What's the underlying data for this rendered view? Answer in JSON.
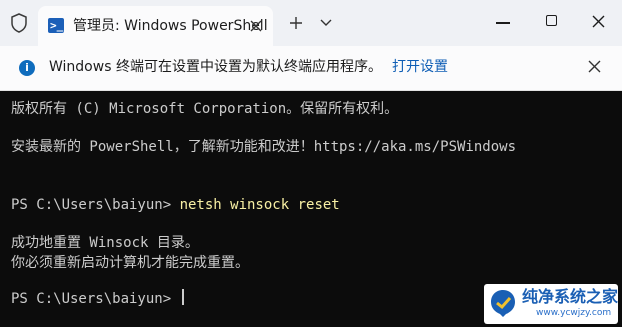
{
  "titlebar": {
    "tab_title": "管理员: Windows PowerShell",
    "tab_icon_glyph": ">_",
    "colors": {
      "background": "#eff1f5",
      "active_tab": "#fbfbfc"
    }
  },
  "infobar": {
    "message": "Windows 终端可在设置中设置为默认终端应用程序。",
    "link_label": "打开设置",
    "info_icon_glyph": "i",
    "colors": {
      "link": "#0f5eb5",
      "icon": "#0f6cbd"
    }
  },
  "terminal": {
    "lines": [
      "版权所有 (C)  Microsoft Corporation。保留所有权利。",
      "安装最新的 PowerShell，了解新功能和改进！https://aka.ms/PSWindows",
      "",
      "",
      "成功地重置 Winsock 目录。",
      "你必须重新启动计算机才能完成重置。",
      ""
    ],
    "prompt1": "PS C:\\Users\\baiyun> ",
    "command1": "netsh winsock reset",
    "prompt2": "PS C:\\Users\\baiyun> ",
    "colors": {
      "background": "#0c0c0c",
      "text": "#cccccc",
      "command": "#f9f1a5"
    }
  },
  "watermark": {
    "title": "纯净系统之家",
    "url": "www.ycwjzy.com"
  }
}
